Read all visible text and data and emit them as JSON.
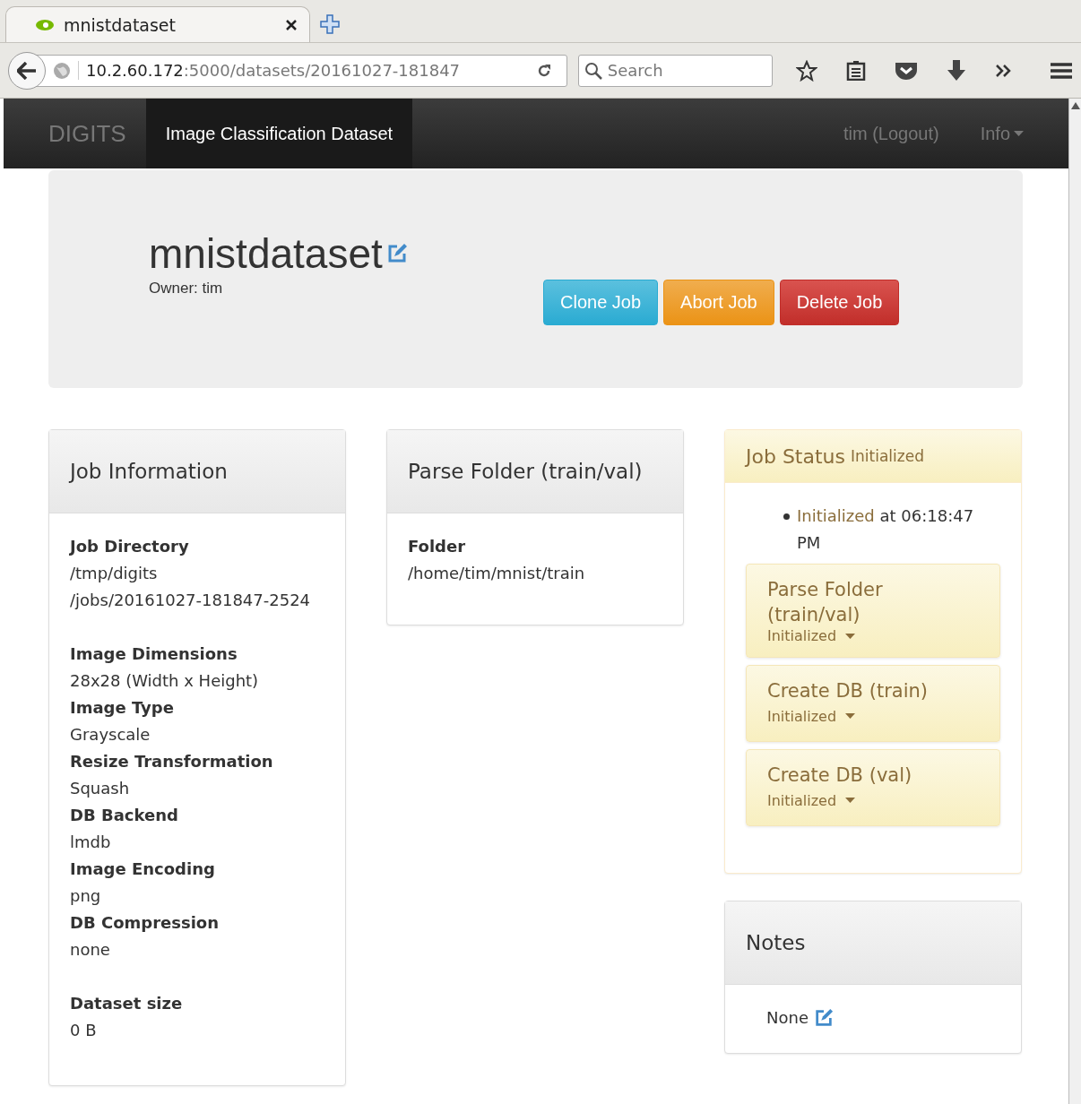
{
  "browser": {
    "tab_title": "mnistdataset",
    "url_host": "10.2.60.172",
    "url_path": ":5000/datasets/20161027-181847",
    "search_placeholder": "Search"
  },
  "navbar": {
    "brand": "DIGITS",
    "items": [
      {
        "label": "Image Classification Dataset",
        "selected": true
      }
    ],
    "user": "tim (Logout)",
    "info": "Info"
  },
  "header": {
    "title": "mnistdataset",
    "owner": "Owner: tim",
    "buttons": [
      {
        "label": "Clone Job",
        "kind": "info"
      },
      {
        "label": "Abort Job",
        "kind": "warning"
      },
      {
        "label": "Delete Job",
        "kind": "danger"
      }
    ]
  },
  "job_info": {
    "title": "Job Information",
    "groups": [
      [
        {
          "label": "Job Directory",
          "lines": [
            "/tmp/digits",
            "/jobs/20161027-181847-2524"
          ]
        }
      ],
      [
        {
          "label": "Image Dimensions",
          "lines": [
            "28x28 (Width x Height)"
          ]
        },
        {
          "label": "Image Type",
          "lines": [
            "Grayscale"
          ]
        },
        {
          "label": "Resize Transformation",
          "lines": [
            "Squash"
          ]
        },
        {
          "label": "DB Backend",
          "lines": [
            "lmdb"
          ]
        },
        {
          "label": "Image Encoding",
          "lines": [
            "png"
          ]
        },
        {
          "label": "DB Compression",
          "lines": [
            "none"
          ]
        }
      ],
      [
        {
          "label": "Dataset size",
          "lines": [
            "0 B"
          ]
        }
      ]
    ]
  },
  "parse_folder": {
    "title": "Parse Folder (train/val)",
    "fields": [
      {
        "label": "Folder",
        "lines": [
          "/home/tim/mnist/train"
        ]
      }
    ]
  },
  "job_status": {
    "title": "Job Status",
    "status": "Initialized",
    "events": [
      {
        "status": "Initialized",
        "text": " at 06:18:47 PM"
      }
    ],
    "tasks": [
      {
        "name": "Parse Folder (train/val)",
        "status": "Initialized"
      },
      {
        "name": "Create DB (train)",
        "status": "Initialized"
      },
      {
        "name": "Create DB (val)",
        "status": "Initialized"
      }
    ]
  },
  "notes": {
    "title": "Notes",
    "value": "None"
  }
}
